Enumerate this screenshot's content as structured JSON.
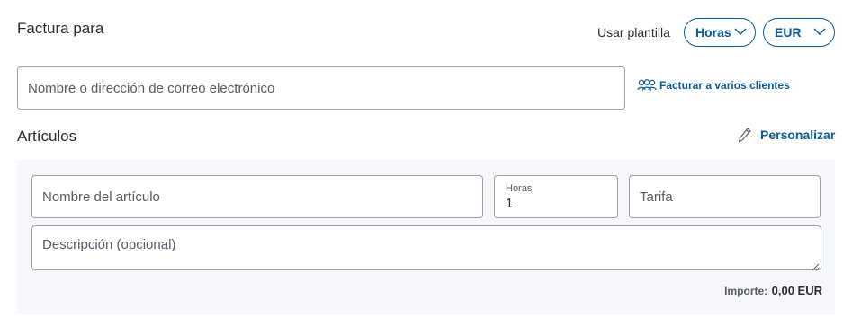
{
  "invoice_to": {
    "title": "Factura para",
    "recipient_placeholder": "Nombre o dirección de correo electrónico",
    "multi_client_link": "Facturar a varios clientes"
  },
  "template": {
    "label": "Usar plantilla",
    "type_selected": "Horas",
    "currency_selected": "EUR"
  },
  "items": {
    "title": "Artículos",
    "customize_link": "Personalizar",
    "item_name_placeholder": "Nombre del artículo",
    "hours_label": "Horas",
    "hours_value": "1",
    "rate_placeholder": "Tarifa",
    "description_placeholder": "Descripción (opcional)",
    "amount_label": "Importe:",
    "amount_value": "0,00 EUR"
  },
  "colors": {
    "accent": "#0a5a9c",
    "panel_bg": "#f5f7fa",
    "border": "#9da3a6"
  },
  "icons": [
    "chevron-down-icon",
    "users-icon",
    "pencil-icon",
    "resize-grip-icon"
  ]
}
